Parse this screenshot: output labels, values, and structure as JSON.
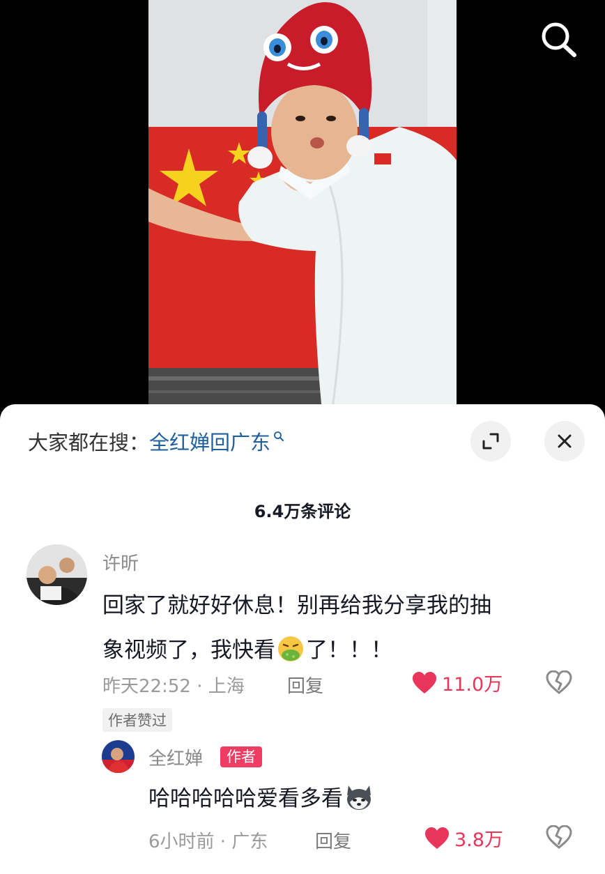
{
  "topbar": {
    "search_icon": "search-icon"
  },
  "sheet": {
    "hot_search_prefix": "大家都在搜：",
    "hot_search_term": "全红婵回广东",
    "expand_icon": "expand-icon",
    "close_icon": "close-icon",
    "comment_count": "6.4万条评论"
  },
  "comments": [
    {
      "username": "许昕",
      "text_line1": "回家了就好好休息！别再给我分享我的抽",
      "text_line2_before": "象视频了，我快看",
      "text_line2_emoji": "vomiting-emoji",
      "text_line2_after": "了！！！",
      "time_location": "昨天22:52 · 上海",
      "reply_label": "回复",
      "like_count": "11.0万",
      "author_liked": "作者赞过"
    },
    {
      "username": "全红婵",
      "badge": "作者",
      "text": "哈哈哈哈哈爱看多看",
      "text_emoji": "husky-emoji",
      "time_location": "6小时前 · 广东",
      "reply_label": "回复",
      "like_count": "3.8万"
    }
  ],
  "colors": {
    "accent_like": "#e8355a",
    "author_badge": "#ef3c62",
    "hot_search_link": "#1f5f9e"
  }
}
